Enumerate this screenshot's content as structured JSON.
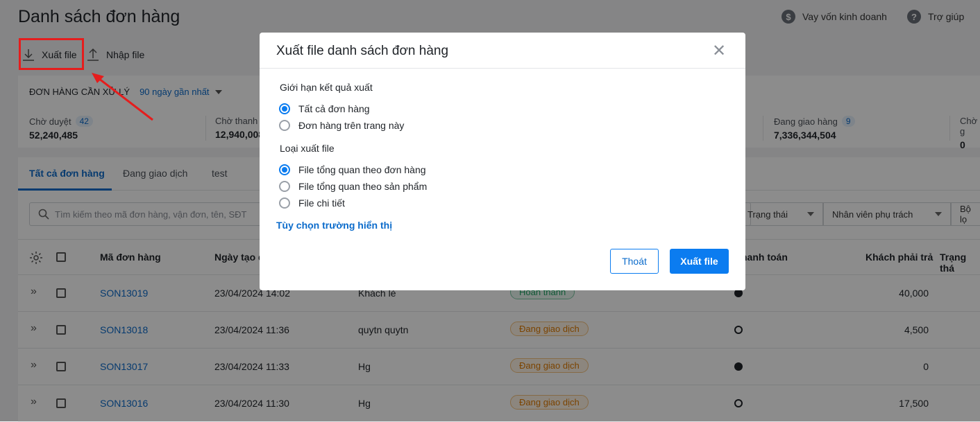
{
  "header": {
    "title": "Danh sách đơn hàng",
    "loan_label": "Vay vốn kinh doanh",
    "help_label": "Trợ giúp"
  },
  "toolbar": {
    "export_label": "Xuất file",
    "import_label": "Nhập file"
  },
  "summary": {
    "heading": "ĐƠN HÀNG CẦN XỬ LÝ",
    "range": "90 ngày gần nhất",
    "items": [
      {
        "label": "Chờ duyệt",
        "count": "42",
        "value": "52,240,485"
      },
      {
        "label": "Chờ thanh",
        "count": "",
        "value": "12,940,008"
      },
      {
        "label": "Đang giao hàng",
        "count": "9",
        "value": "7,336,344,504"
      },
      {
        "label": "Chờ g",
        "count": "",
        "value": "0"
      }
    ]
  },
  "tabs": [
    "Tất cả đơn hàng",
    "Đang giao dịch",
    "test"
  ],
  "filters": {
    "search_placeholder": "Tìm kiếm theo mã đơn hàng, vận đơn, tên, SĐT",
    "status": "Trạng thái",
    "staff": "Nhân viên phụ trách",
    "more": "Bộ lọ"
  },
  "table": {
    "headers": {
      "code": "Mã đơn hàng",
      "date": "Ngày tạo đ",
      "payment": "hanh toán",
      "due": "Khách phải trả",
      "status": "Trạng thá"
    },
    "rows": [
      {
        "code": "SON13019",
        "date": "23/04/2024 14:02",
        "customer": "Khách lẻ",
        "status": "Hoàn thành",
        "paid": "filled",
        "due": "40,000"
      },
      {
        "code": "SON13018",
        "date": "23/04/2024 11:36",
        "customer": "quytn quytn",
        "status": "Đang giao dịch",
        "paid": "empty",
        "due": "4,500"
      },
      {
        "code": "SON13017",
        "date": "23/04/2024 11:33",
        "customer": "Hg",
        "status": "Đang giao dịch",
        "paid": "filled",
        "due": "0"
      },
      {
        "code": "SON13016",
        "date": "23/04/2024 11:30",
        "customer": "Hg",
        "status": "Đang giao dịch",
        "paid": "empty",
        "due": "17,500"
      }
    ]
  },
  "modal": {
    "title": "Xuất file danh sách đơn hàng",
    "limit_label": "Giới hạn kết quả xuất",
    "limit_options": [
      "Tất cả đơn hàng",
      "Đơn hàng trên trang này"
    ],
    "limit_selected": 0,
    "type_label": "Loại xuất file",
    "type_options": [
      "File tổng quan theo đơn hàng",
      "File tổng quan theo sản phẩm",
      "File chi tiết"
    ],
    "type_selected": 0,
    "fields_link": "Tùy chọn trường hiển thị",
    "cancel_label": "Thoát",
    "export_label": "Xuất file"
  },
  "colors": {
    "accent": "#0b7cf0",
    "annotation": "#e51d1d"
  }
}
